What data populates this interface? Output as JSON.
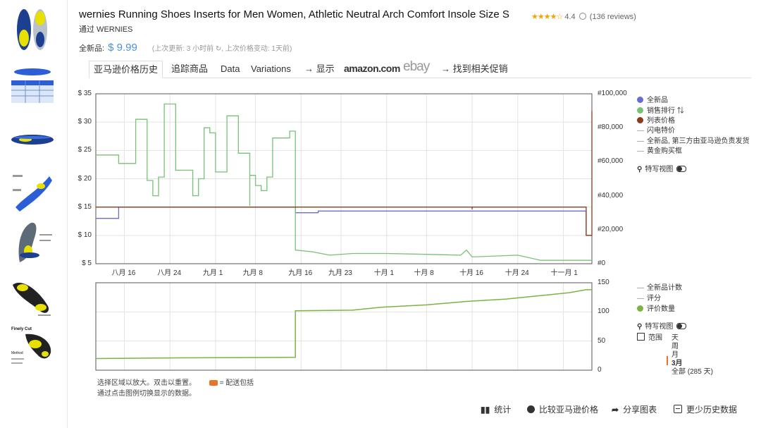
{
  "product": {
    "title": "wernies Running Shoes Inserts for Men Women, Athletic Neutral Arch Comfort Insole Size S",
    "stars": "★★★★☆",
    "rating": "4.4",
    "reviews": "(136 reviews)",
    "by": "通过 WERNIES"
  },
  "price_row": {
    "label": "全新品:",
    "price": "$ 9.99",
    "meta": "(上次更新: 3 小时前 ↻, 上次价格变动: 1天前)"
  },
  "tabs": {
    "history": "亚马逊价格历史",
    "track": "追踪商品",
    "data": "Data",
    "variations": "Variations",
    "show": "→ 显示",
    "amazon": "amazon.com",
    "ebay": "ebay",
    "promo": "→ 找到相关促销"
  },
  "chart_data": [
    {
      "type": "line",
      "x_ticks": [
        "八月 16",
        "八月 24",
        "九月 1",
        "九月 8",
        "九月 16",
        "九月 23",
        "十月 1",
        "十月 8",
        "十月 16",
        "十月 24",
        "十一月 1"
      ],
      "y_left_ticks": [
        "$ 35",
        "$ 30",
        "$ 25",
        "$ 20",
        "$ 15",
        "$ 10",
        "$ 5"
      ],
      "y_right_ticks": [
        "#100,000",
        "#80,000",
        "#60,000",
        "#40,000",
        "#20,000",
        "#0"
      ],
      "ylim_left": [
        5,
        35
      ],
      "ylim_right": [
        0,
        100000
      ],
      "series": [
        {
          "name": "全新品",
          "color": "#6b6bd8",
          "axis": "left",
          "points": [
            [
              "Aug 11",
              13
            ],
            [
              "Aug 15",
              13
            ],
            [
              "Aug 15",
              15
            ],
            [
              "Sep 15",
              15
            ],
            [
              "Sep 15",
              14
            ],
            [
              "Sep 19",
              14
            ],
            [
              "Sep 19",
              14.3
            ],
            [
              "Nov 5",
              14.3
            ],
            [
              "Nov 5",
              10
            ],
            [
              "Nov 6",
              10
            ]
          ]
        },
        {
          "name": "销售排行",
          "color": "#76c276",
          "axis": "right",
          "points": [
            [
              "Aug 11",
              64000
            ],
            [
              "Aug 15",
              64000
            ],
            [
              "Aug 15",
              59000
            ],
            [
              "Aug 18",
              59000
            ],
            [
              "Aug 18",
              85000
            ],
            [
              "Aug 20",
              85000
            ],
            [
              "Aug 20",
              49000
            ],
            [
              "Aug 21",
              49000
            ],
            [
              "Aug 21",
              40000
            ],
            [
              "Aug 22",
              40000
            ],
            [
              "Aug 22",
              51000
            ],
            [
              "Aug 23",
              51000
            ],
            [
              "Aug 23",
              94000
            ],
            [
              "Aug 25",
              94000
            ],
            [
              "Aug 25",
              55000
            ],
            [
              "Aug 28",
              55000
            ],
            [
              "Aug 28",
              40000
            ],
            [
              "Aug 29",
              40000
            ],
            [
              "Aug 29",
              50000
            ],
            [
              "Aug 30",
              50000
            ],
            [
              "Aug 30",
              80000
            ],
            [
              "Aug 31",
              80000
            ],
            [
              "Aug 31",
              77000
            ],
            [
              "Sep 1",
              77000
            ],
            [
              "Sep 1",
              54000
            ],
            [
              "Sep 3",
              54000
            ],
            [
              "Sep 3",
              87000
            ],
            [
              "Sep 5",
              87000
            ],
            [
              "Sep 5",
              65000
            ],
            [
              "Sep 7",
              65000
            ],
            [
              "Sep 7",
              34000
            ],
            [
              "Sep 7",
              52000
            ],
            [
              "Sep 8",
              52000
            ],
            [
              "Sep 8",
              46000
            ],
            [
              "Sep 9",
              46000
            ],
            [
              "Sep 9",
              43000
            ],
            [
              "Sep 10",
              43000
            ],
            [
              "Sep 10",
              51000
            ],
            [
              "Sep 11",
              51000
            ],
            [
              "Sep 11",
              74000
            ],
            [
              "Sep 14",
              74000
            ],
            [
              "Sep 14",
              78000
            ],
            [
              "Sep 15",
              78000
            ],
            [
              "Sep 15",
              8000
            ],
            [
              "Sep 18",
              7000
            ],
            [
              "Sep 21",
              5000
            ],
            [
              "Sep 25",
              6000
            ],
            [
              "Oct 1",
              6000
            ],
            [
              "Oct 8",
              5500
            ],
            [
              "Oct 14",
              5000
            ],
            [
              "Oct 15",
              8000
            ],
            [
              "Oct 16",
              4000
            ],
            [
              "Oct 24",
              5000
            ],
            [
              "Oct 28",
              2000
            ],
            [
              "Nov 6",
              2000
            ]
          ]
        },
        {
          "name": "列表价格",
          "color": "#8b3a1a",
          "axis": "left",
          "points": [
            [
              "Aug 11",
              15
            ],
            [
              "Oct 16",
              15
            ],
            [
              "Oct 16",
              14.6
            ],
            [
              "Oct 16",
              15
            ],
            [
              "Nov 5",
              15
            ],
            [
              "Nov 5",
              10
            ],
            [
              "Nov 6",
              10
            ],
            [
              "Nov 6",
              32
            ]
          ]
        }
      ]
    },
    {
      "type": "line",
      "y_ticks": [
        "150",
        "100",
        "50",
        "0"
      ],
      "ylim": [
        0,
        150
      ],
      "series": [
        {
          "name": "评价数量",
          "color": "#7cb342",
          "points": [
            [
              "Aug 11",
              20
            ],
            [
              "Aug 24",
              21
            ],
            [
              "Sep 15",
              22
            ],
            [
              "Sep 15",
              102
            ],
            [
              "Sep 25",
              103
            ],
            [
              "Sep 30",
              108
            ],
            [
              "Oct 8",
              112
            ],
            [
              "Oct 15",
              118
            ],
            [
              "Oct 22",
              122
            ],
            [
              "Oct 28",
              128
            ],
            [
              "Nov 2",
              133
            ],
            [
              "Nov 5",
              138
            ],
            [
              "Nov 6",
              138
            ]
          ]
        }
      ]
    }
  ],
  "legend_top": {
    "new": "全新品",
    "rank": "销售排行",
    "rank_icon": "⇅",
    "list_price": "列表价格",
    "lightning": "闪电特价",
    "fba": "全新品, 第三方由亚马逊负责发货",
    "buybox": "黄金购买框",
    "closeup": "特写视图"
  },
  "legend_bottom": {
    "new_count": "全新品计数",
    "rating": "评分",
    "review_count": "评价数量",
    "closeup": "特写视图",
    "range_label": "范围",
    "day": "天",
    "week": "周",
    "month": "月",
    "three_month": "3月",
    "all": "全部 (285 天)"
  },
  "notes": {
    "zoom": "选择区域以放大。双击以重置。",
    "shipping": "= 配送包括",
    "toggle": "通过点击图例切换显示的数据。"
  },
  "actions": {
    "stats": "统计",
    "compare": "比较亚马逊价格",
    "share": "分享图表",
    "less": "更少历史数据"
  },
  "thumbnail_captions": {
    "t7a": "Finely Cut",
    "t7b": "Method"
  },
  "colors": {
    "accent_blue": "#4a90e2",
    "new_dot": "#6b6bd8",
    "rank_dot": "#76c276",
    "list_dot": "#8b3a1a",
    "review_dot": "#7cb342",
    "range_marker": "#e8742a"
  }
}
